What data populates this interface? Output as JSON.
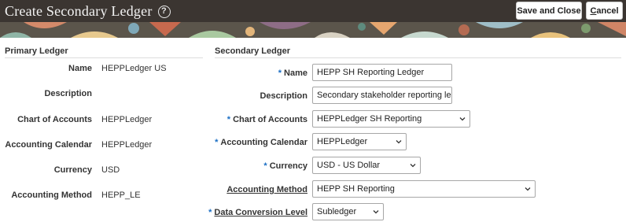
{
  "header": {
    "title": "Create Secondary Ledger",
    "save_label": "Save and Close",
    "cancel_accel": "C",
    "cancel_rest": "ancel"
  },
  "primary": {
    "heading": "Primary Ledger",
    "fields": [
      {
        "label": "Name",
        "value": "HEPPLedger US"
      },
      {
        "label": "Description",
        "value": ""
      },
      {
        "label": "Chart of Accounts",
        "value": "HEPPLedger"
      },
      {
        "label": "Accounting Calendar",
        "value": "HEPPLedger"
      },
      {
        "label": "Currency",
        "value": "USD"
      },
      {
        "label": "Accounting Method",
        "value": "HEPP_LE"
      }
    ]
  },
  "secondary": {
    "heading": "Secondary Ledger",
    "required_mark": "*",
    "name": {
      "label": "Name",
      "value": "HEPP SH Reporting Ledger"
    },
    "description": {
      "label": "Description",
      "value": "Secondary stakeholder reporting ledge"
    },
    "chart_of_accounts": {
      "label": "Chart of Accounts",
      "value": "HEPPLedger SH Reporting"
    },
    "accounting_calendar": {
      "label": "Accounting Calendar",
      "value": "HEPPLedger"
    },
    "currency": {
      "label": "Currency",
      "value": "USD - US Dollar"
    },
    "accounting_method": {
      "label": "Accounting Method",
      "value": "HEPP SH Reporting"
    },
    "data_conversion_level": {
      "label": "Data Conversion Level",
      "value": "Subledger"
    }
  },
  "colors": {
    "header_bg": "#3b3531",
    "required": "#1a6ec4"
  }
}
